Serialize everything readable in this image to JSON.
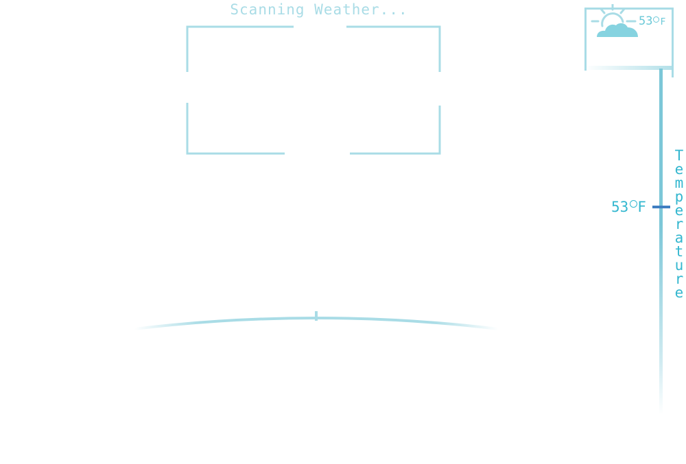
{
  "scanner": {
    "status_text": "Scanning Weather..."
  },
  "widget": {
    "icon": "partly-cloudy-icon",
    "temp_value": "53",
    "temp_unit": "F"
  },
  "gauge": {
    "label": "Temperature",
    "reading_value": "53",
    "reading_unit": "F",
    "level": 53
  },
  "colors": {
    "accent_light": "#a9dce6",
    "accent": "#34b7cf",
    "marker": "#3f7ec1",
    "cloud": "#86d3e0"
  }
}
